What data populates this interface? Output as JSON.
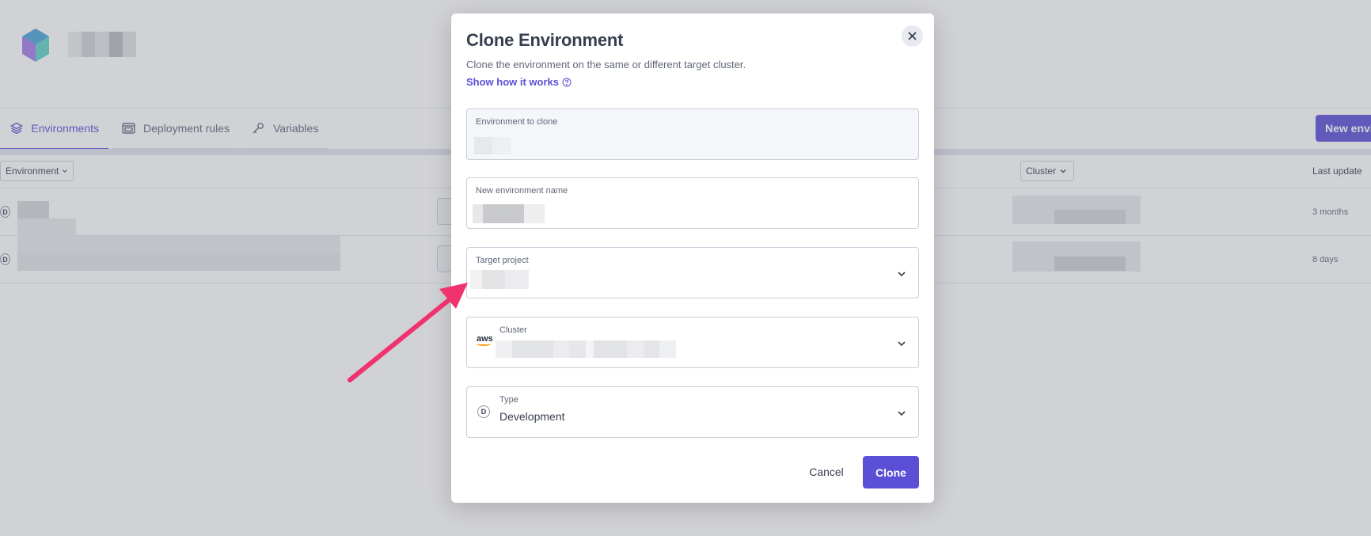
{
  "background": {
    "tabs": [
      {
        "label": "Environments",
        "icon": "layers-icon",
        "active": true
      },
      {
        "label": "Deployment rules",
        "icon": "window-icon",
        "active": false
      },
      {
        "label": "Variables",
        "icon": "key-icon",
        "active": false
      }
    ],
    "new_env_button": "New envir",
    "columns": {
      "environment": "Environment",
      "cluster": "Cluster",
      "last_update": "Last update"
    },
    "rows": [
      {
        "type_badge": "D",
        "last_update": "3 months"
      },
      {
        "type_badge": "D",
        "last_update": "8 days"
      }
    ]
  },
  "modal": {
    "title": "Clone Environment",
    "description": "Clone the environment on the same or different target cluster.",
    "how_link": "Show how it works",
    "fields": {
      "env_to_clone": {
        "label": "Environment to clone"
      },
      "new_name": {
        "label": "New environment name"
      },
      "target_project": {
        "label": "Target project"
      },
      "cluster": {
        "label": "Cluster",
        "provider": "aws"
      },
      "type": {
        "label": "Type",
        "value": "Development",
        "badge": "D"
      }
    },
    "cancel_label": "Cancel",
    "clone_label": "Clone"
  },
  "colors": {
    "accent": "#5b4fd6",
    "arrow": "#f0326f"
  }
}
